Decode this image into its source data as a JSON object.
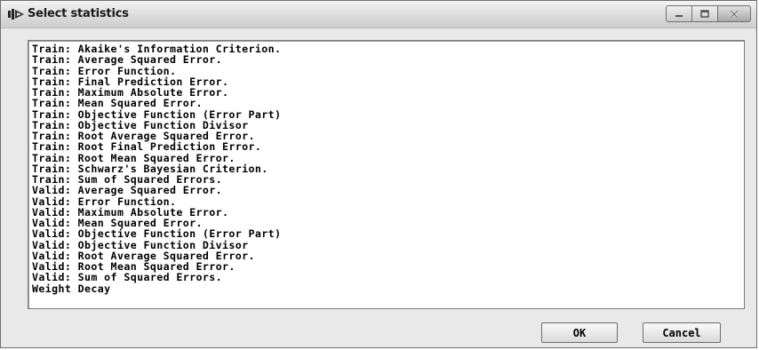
{
  "window": {
    "title": "Select statistics",
    "buttons": {
      "minimize_icon": "minimize-icon",
      "maximize_icon": "maximize-icon",
      "close_icon": "close-icon"
    }
  },
  "statistics_list": [
    "Train: Akaike's Information Criterion.",
    "Train: Average Squared Error.",
    "Train: Error Function.",
    "Train: Final Prediction Error.",
    "Train: Maximum Absolute Error.",
    "Train: Mean Squared Error.",
    "Train: Objective Function (Error Part)",
    "Train: Objective Function Divisor",
    "Train: Root Average Squared Error.",
    "Train: Root Final Prediction Error.",
    "Train: Root Mean Squared Error.",
    "Train: Schwarz's Bayesian Criterion.",
    "Train: Sum of Squared Errors.",
    "Valid: Average Squared Error.",
    "Valid: Error Function.",
    "Valid: Maximum Absolute Error.",
    "Valid: Mean Squared Error.",
    "Valid: Objective Function (Error Part)",
    "Valid: Objective Function Divisor",
    "Valid: Root Average Squared Error.",
    "Valid: Root Mean Squared Error.",
    "Valid: Sum of Squared Errors.",
    "Weight Decay"
  ],
  "actions": {
    "ok_label": "OK",
    "cancel_label": "Cancel"
  }
}
